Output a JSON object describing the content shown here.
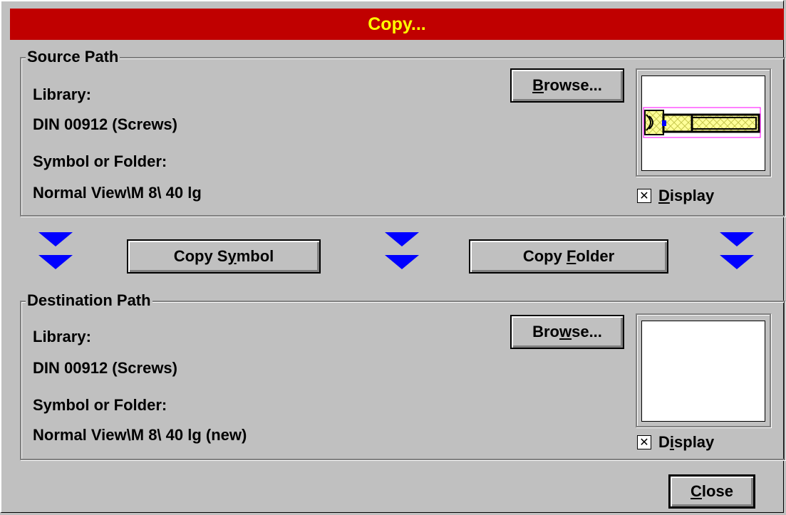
{
  "dialog": {
    "title": "Copy..."
  },
  "source": {
    "legend": "Source Path",
    "library_label": "Library:",
    "library_value": "DIN 00912 (Screws)",
    "symbol_label": "Symbol or Folder:",
    "symbol_value": "Normal View\\M  8\\ 40  lg",
    "browse": {
      "pre": "",
      "accel": "B",
      "post": "rowse..."
    },
    "display": {
      "accel": "D",
      "post": "isplay",
      "checked": true
    }
  },
  "actions": {
    "copy_symbol": {
      "pre": "Copy S",
      "accel": "y",
      "post": "mbol"
    },
    "copy_folder": {
      "pre": "Copy ",
      "accel": "F",
      "post": "older"
    }
  },
  "destination": {
    "legend": "Destination Path",
    "library_label": "Library:",
    "library_value": "DIN 00912 (Screws)",
    "symbol_label": "Symbol or Folder:",
    "symbol_value": "Normal View\\M  8\\ 40  lg (new)",
    "browse": {
      "pre": "Bro",
      "accel": "w",
      "post": "se..."
    },
    "display": {
      "pre": "D",
      "accel": "i",
      "post": "splay",
      "checked": true
    }
  },
  "close": {
    "accel": "C",
    "post": "lose"
  },
  "colors": {
    "title_bg": "#c00000",
    "title_fg": "#ffff00",
    "arrow": "#0000ff"
  }
}
